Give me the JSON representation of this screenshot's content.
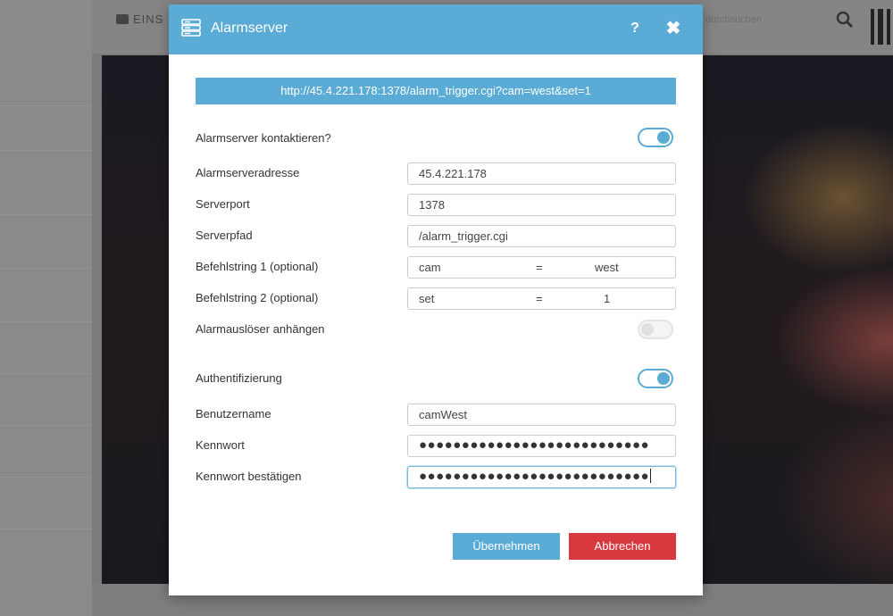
{
  "background": {
    "tab_label": "EINS",
    "faded_text": "durchsuchen"
  },
  "modal": {
    "title": "Alarmserver",
    "help_label": "?",
    "url": "http://45.4.221.178:1378/alarm_trigger.cgi?cam=west&set=1",
    "contact_label": "Alarmserver kontaktieren?",
    "contact_enabled": true,
    "address_label": "Alarmserveradresse",
    "address_value": "45.4.221.178",
    "port_label": "Serverport",
    "port_value": "1378",
    "path_label": "Serverpfad",
    "path_value": "/alarm_trigger.cgi",
    "cmd1_label": "Befehlstring 1 (optional)",
    "cmd1_key": "cam",
    "cmd1_eq": "=",
    "cmd1_value": "west",
    "cmd2_label": "Befehlstring 2 (optional)",
    "cmd2_key": "set",
    "cmd2_eq": "=",
    "cmd2_value": "1",
    "trigger_label": "Alarmauslöser anhängen",
    "trigger_enabled": false,
    "auth_label": "Authentifizierung",
    "auth_enabled": true,
    "user_label": "Benutzername",
    "user_value": "camWest",
    "password_label": "Kennwort",
    "password_mask": "●●●●●●●●●●●●●●●●●●●●●●●●●●●",
    "confirm_label": "Kennwort bestätigen",
    "confirm_mask": "●●●●●●●●●●●●●●●●●●●●●●●●●●●",
    "apply_label": "Übernehmen",
    "cancel_label": "Abbrechen"
  },
  "colors": {
    "accent": "#5aabd6",
    "danger": "#d8393f"
  }
}
